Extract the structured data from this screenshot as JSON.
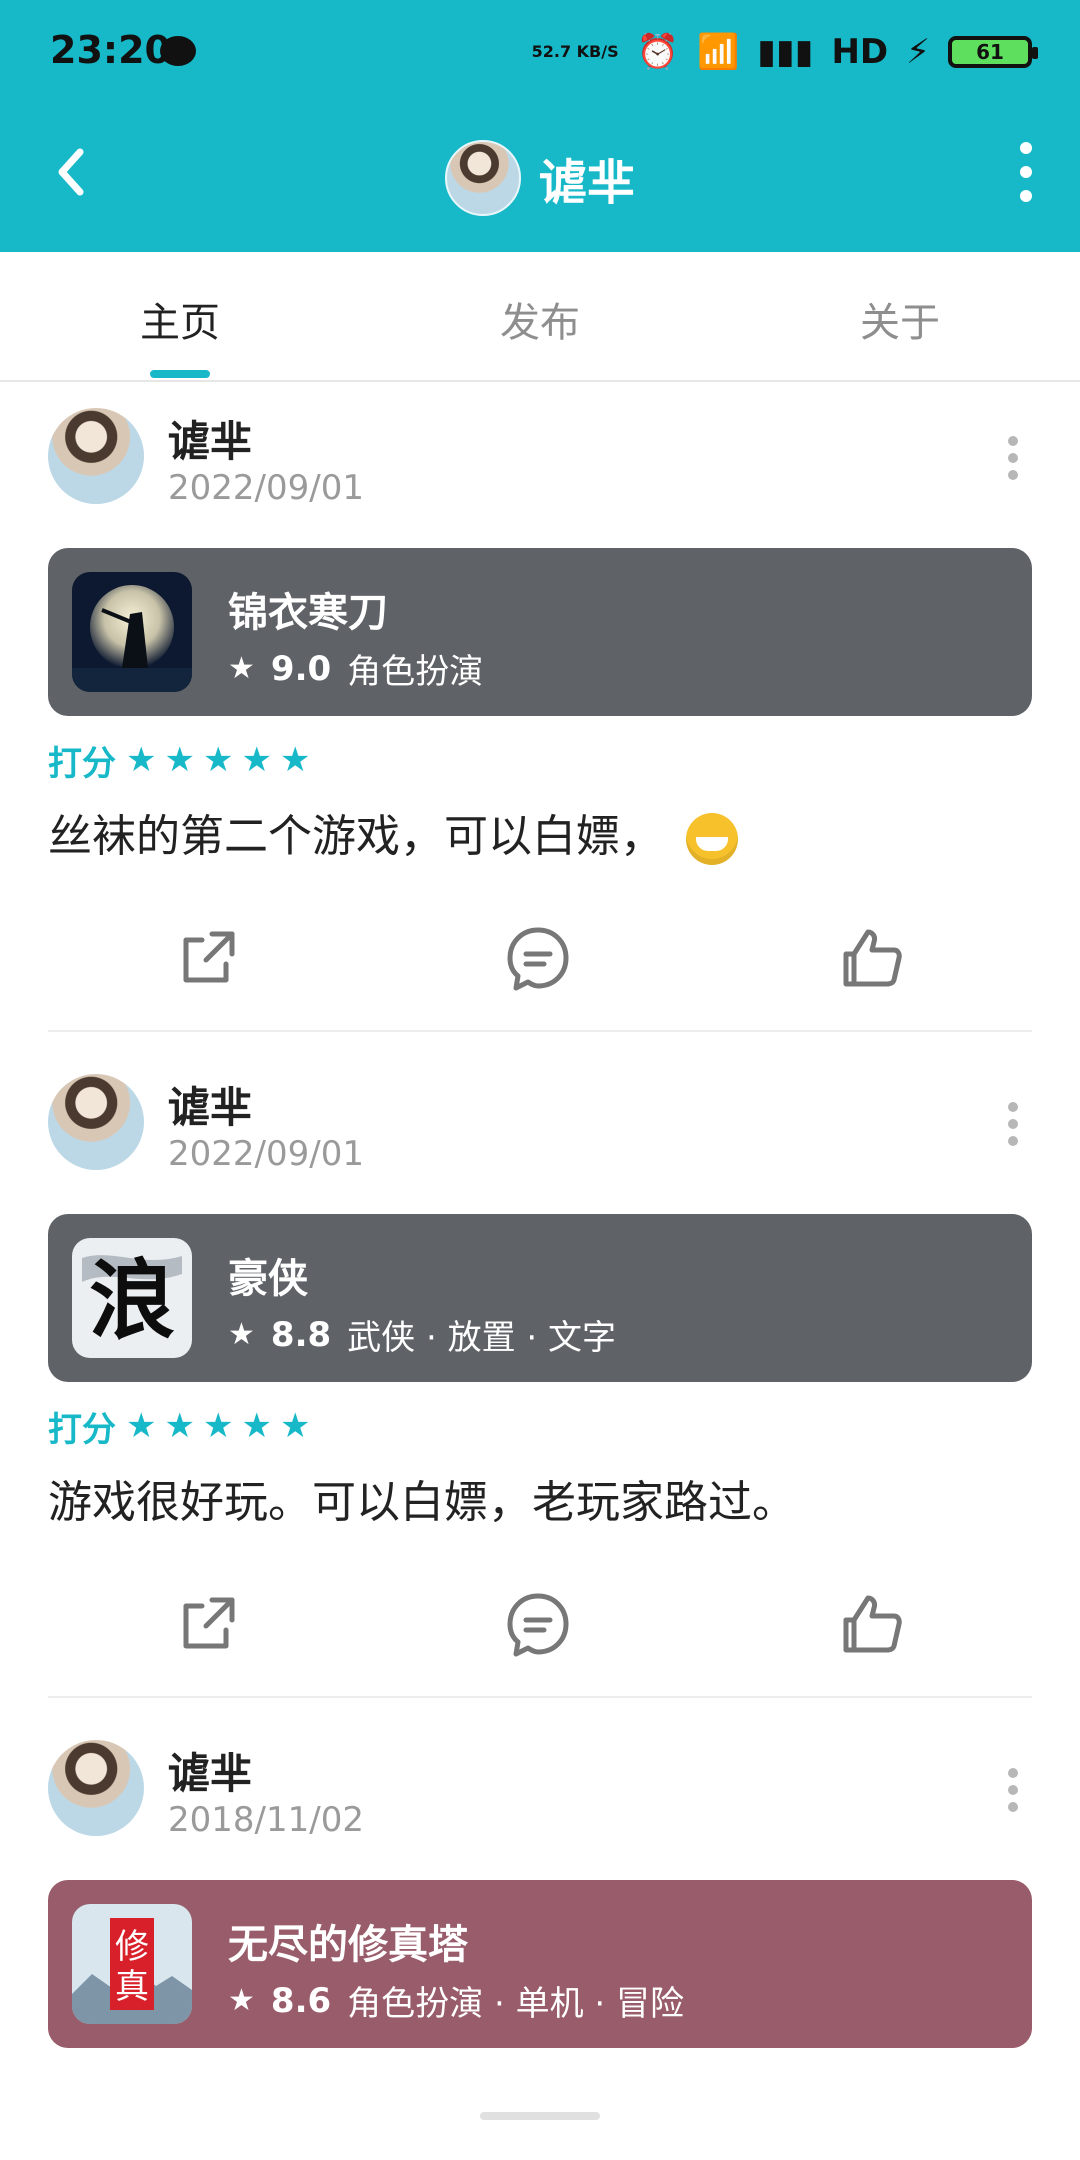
{
  "status": {
    "time": "23:20",
    "speed": "52.7 KB/S",
    "battery": "61"
  },
  "appbar": {
    "title": "谑芈"
  },
  "tabs": [
    {
      "label": "主页"
    },
    {
      "label": "发布"
    },
    {
      "label": "关于"
    }
  ],
  "posts": [
    {
      "author": "谑芈",
      "date": "2022/09/01",
      "game": {
        "title": "锦衣寒刀",
        "score": "9.0",
        "meta": "角色扮演",
        "bg": "#5f6266"
      },
      "rating_label": "打分",
      "stars": 5,
      "comment": "丝袜的第二个游戏，可以白嫖，"
    },
    {
      "author": "谑芈",
      "date": "2022/09/01",
      "game": {
        "title": "豪侠",
        "score": "8.8",
        "meta": "武侠 · 放置 · 文字",
        "bg": "#5f6368"
      },
      "rating_label": "打分",
      "stars": 5,
      "comment": "游戏很好玩。可以白嫖，老玩家路过。"
    },
    {
      "author": "谑芈",
      "date": "2018/11/02",
      "game": {
        "title": "无尽的修真塔",
        "score": "8.6",
        "meta": "角色扮演 · 单机 · 冒险",
        "bg": "#985c6a"
      }
    }
  ]
}
